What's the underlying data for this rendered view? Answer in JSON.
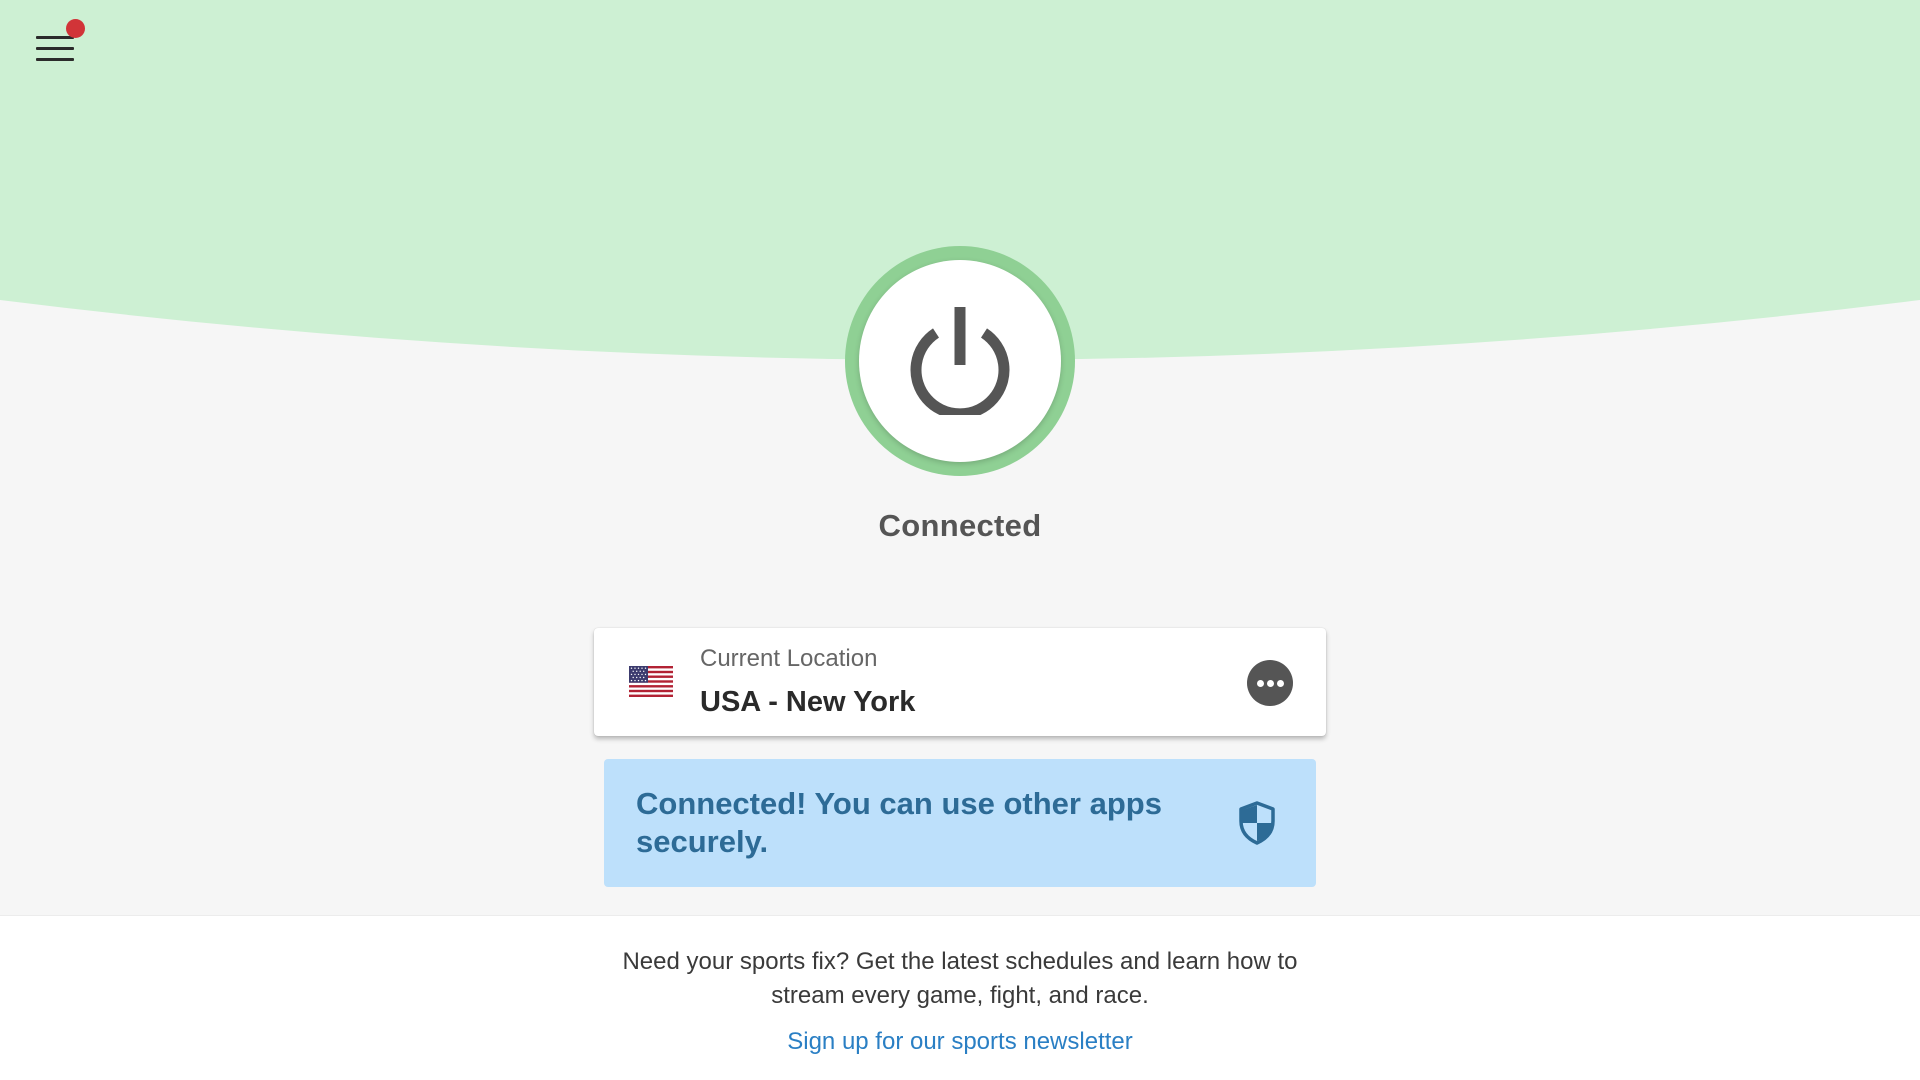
{
  "header": {
    "menu_icon": "hamburger-menu-icon",
    "notification_indicator": "red-dot"
  },
  "connection": {
    "power_icon": "power-icon",
    "status": "Connected"
  },
  "location": {
    "caption": "Current Location",
    "name": "USA - New York",
    "flag_icon": "us-flag-icon",
    "more_icon": "more-options-icon"
  },
  "banner": {
    "message": "Connected! You can use other apps securely.",
    "icon": "shield-icon"
  },
  "footer": {
    "promo": "Need your sports fix? Get the latest schedules and learn how to stream every game, fight, and race.",
    "link": "Sign up for our sports newsletter"
  },
  "colors": {
    "connected_green": "#cdf0d3",
    "ring_green": "#8fd094",
    "banner_blue": "#bde0fb",
    "banner_text": "#2d6b96",
    "link_blue": "#2a7fc4",
    "notification_red": "#d13438"
  }
}
